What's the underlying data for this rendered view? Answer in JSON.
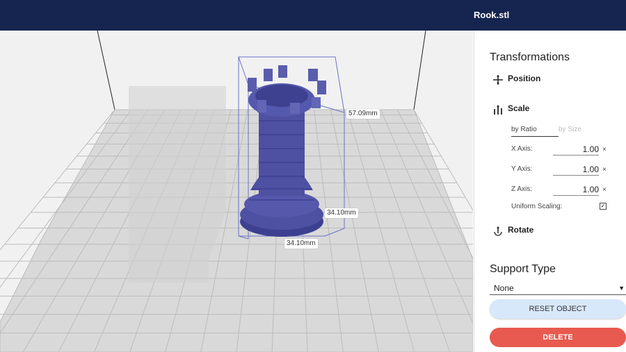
{
  "window": {
    "title": "Rook.stl"
  },
  "viewport": {
    "object_label": "rook-model",
    "dimensions": {
      "height": "57.09mm",
      "depth": "34.10mm",
      "width": "34.10mm"
    }
  },
  "panel": {
    "transformations_title": "Transformations",
    "position_label": "Position",
    "scale_label": "Scale",
    "scale_tabs": {
      "by_ratio": "by Ratio",
      "by_size": "by Size"
    },
    "axes": [
      {
        "label": "X Axis:",
        "value": "1.00",
        "unit": "×"
      },
      {
        "label": "Y Axis:",
        "value": "1.00",
        "unit": "×"
      },
      {
        "label": "Z Axis:",
        "value": "1.00",
        "unit": "×"
      }
    ],
    "uniform_scaling_label": "Uniform Scaling:",
    "uniform_scaling_checked": true,
    "rotate_label": "Rotate",
    "support_type_title": "Support Type",
    "support_type_value": "None",
    "reset_label": "RESET OBJECT",
    "delete_label": "DELETE"
  },
  "colors": {
    "topbar": "#16254f",
    "model": "#4e51a1",
    "reset_button": "#d8e8fb",
    "delete_button": "#e85a4f"
  }
}
